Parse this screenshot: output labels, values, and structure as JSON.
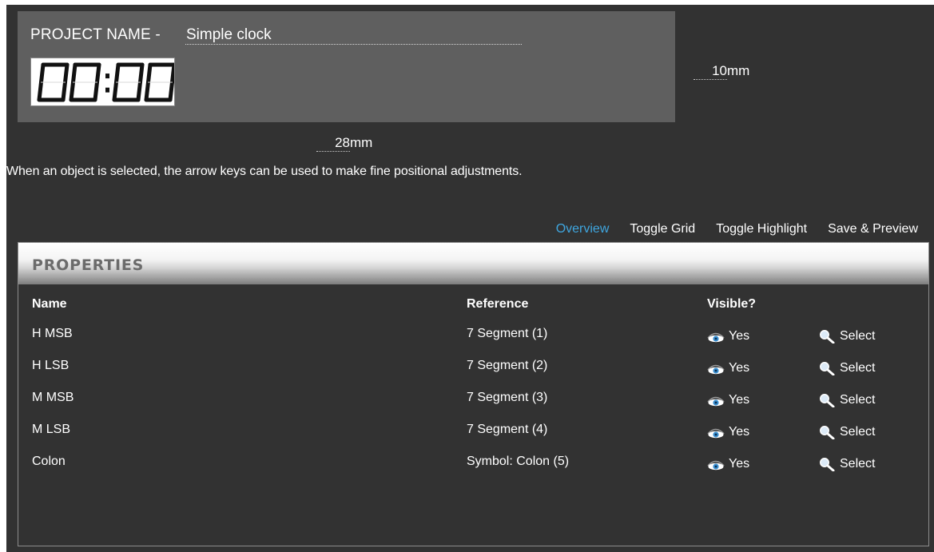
{
  "project": {
    "label": "PROJECT NAME - ",
    "name": "Simple clock"
  },
  "clock_display": "00:00",
  "dimensions": {
    "width_value": "28",
    "width_unit": "mm",
    "height_value": "10",
    "height_unit": "mm"
  },
  "hint": "When an object is selected, the arrow keys can be used to make fine positional adjustments.",
  "toolbar": {
    "overview": "Overview",
    "toggle_grid": "Toggle Grid",
    "toggle_highlight": "Toggle Highlight",
    "save_preview": "Save & Preview"
  },
  "properties": {
    "title": "PROPERTIES",
    "columns": {
      "name": "Name",
      "reference": "Reference",
      "visible": "Visible?"
    },
    "rows": [
      {
        "name": "H MSB",
        "reference": "7 Segment (1)",
        "visible": "Yes",
        "action": "Select"
      },
      {
        "name": "H LSB",
        "reference": "7 Segment (2)",
        "visible": "Yes",
        "action": "Select"
      },
      {
        "name": "M MSB",
        "reference": "7 Segment (3)",
        "visible": "Yes",
        "action": "Select"
      },
      {
        "name": "M LSB",
        "reference": "7 Segment (4)",
        "visible": "Yes",
        "action": "Select"
      },
      {
        "name": "Colon",
        "reference": "Symbol: Colon (5)",
        "visible": "Yes",
        "action": "Select"
      }
    ]
  },
  "colors": {
    "background": "#323232",
    "canvas": "#5f5f5f",
    "accent": "#3fa6df",
    "eye_icon": "#3a8fd0"
  },
  "icons": {
    "visible": "eye-icon",
    "select": "magnifier-icon"
  }
}
